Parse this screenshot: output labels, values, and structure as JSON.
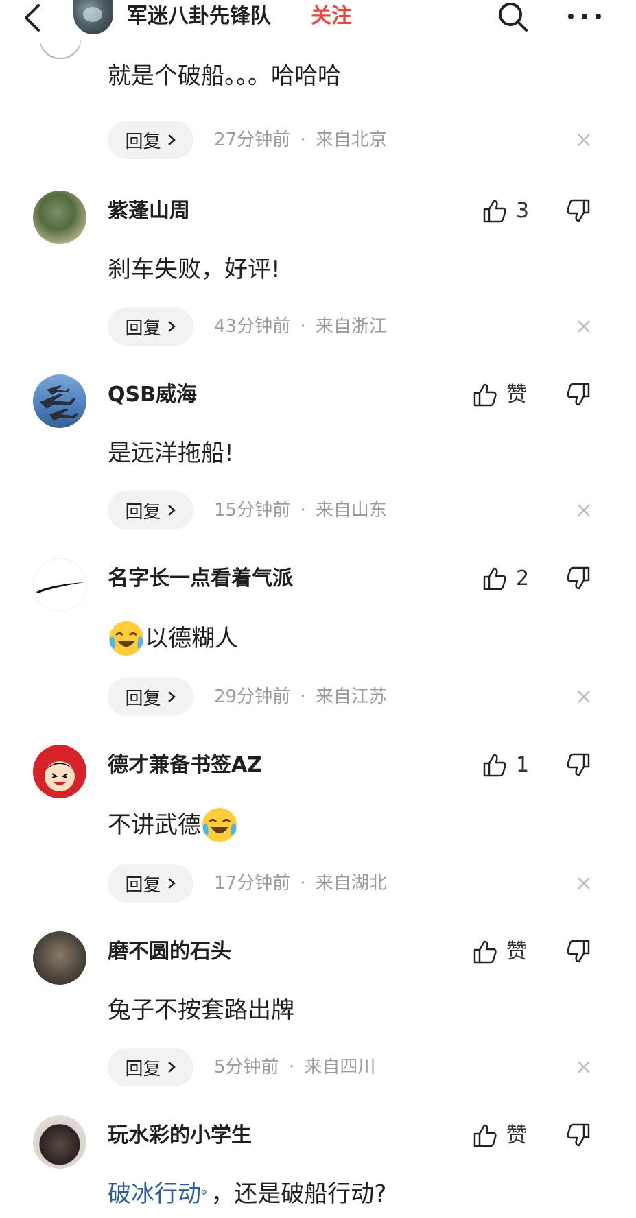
{
  "header": {
    "title": "军迷八卦先锋队",
    "follow_label": "关注",
    "back_icon": "back-arrow-icon",
    "search_icon": "search-icon",
    "more_icon": "more-icon"
  },
  "colors": {
    "accent_red": "#e8473f",
    "link_blue": "#2e5b9d",
    "meta_gray": "#9b9b9b"
  },
  "first_comment": {
    "text": "就是个破船。。。哈哈哈",
    "reply_label": "回复",
    "time": "27分钟前",
    "location": "来自北京"
  },
  "comments": [
    {
      "username": "紫蓬山周",
      "likes": "3",
      "text": "刹车失败，好评!",
      "reply_label": "回复",
      "time": "43分钟前",
      "location": "来自浙江"
    },
    {
      "username": "QSB威海",
      "likes": "赞",
      "text": "是远洋拖船!",
      "reply_label": "回复",
      "time": "15分钟前",
      "location": "来自山东"
    },
    {
      "username": "名字长一点看着气派",
      "likes": "2",
      "text": "以德糊人",
      "reply_label": "回复",
      "time": "29分钟前",
      "location": "来自江苏"
    },
    {
      "username": "德才兼备书签AZ",
      "likes": "1",
      "text": "不讲武德",
      "reply_label": "回复",
      "time": "17分钟前",
      "location": "来自湖北"
    },
    {
      "username": "磨不圆的石头",
      "likes": "赞",
      "text": "兔子不按套路出牌",
      "reply_label": "回复",
      "time": "5分钟前",
      "location": "来自四川"
    },
    {
      "username": "玩水彩的小学生",
      "likes": "赞",
      "text_link": "破冰行动",
      "text_rest": "，还是破船行动?"
    }
  ],
  "separator": "·"
}
